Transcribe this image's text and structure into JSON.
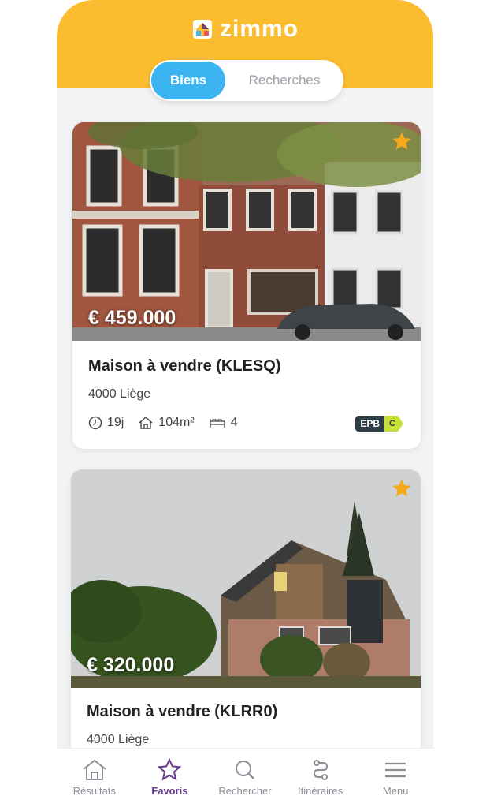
{
  "app": {
    "logo_text": "zimmo"
  },
  "segmented": {
    "biens": "Biens",
    "recherches": "Recherches"
  },
  "listings": [
    {
      "price": "€ 459.000",
      "title": "Maison à vendre (KLESQ)",
      "city": "4000 Liège",
      "days": "19j",
      "area": "104m²",
      "bedrooms": "4",
      "epb_label": "EPB",
      "epb_class": "C"
    },
    {
      "price": "€ 320.000",
      "title": "Maison à vendre (KLRR0)",
      "city": "4000 Liège"
    }
  ],
  "tabbar": {
    "items": [
      {
        "label": "Résultats",
        "icon": "house-icon"
      },
      {
        "label": "Favoris",
        "icon": "star-icon"
      },
      {
        "label": "Rechercher",
        "icon": "search-icon"
      },
      {
        "label": "Itinéraires",
        "icon": "route-icon"
      },
      {
        "label": "Menu",
        "icon": "hamburger-icon"
      }
    ]
  },
  "colors": {
    "brand_yellow": "#fbbd2f",
    "active_blue": "#3db4f2",
    "active_purple": "#6a3b8e",
    "fav_star": "#f7a81b"
  }
}
